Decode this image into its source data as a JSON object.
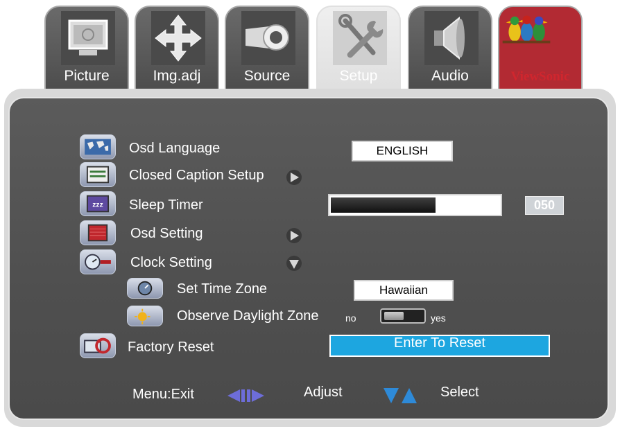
{
  "tabs": [
    {
      "label": "Picture",
      "icon": "monitor-icon"
    },
    {
      "label": "Img.adj",
      "icon": "move-arrows-icon"
    },
    {
      "label": "Source",
      "icon": "connector-icon"
    },
    {
      "label": "Setup",
      "icon": "tools-icon",
      "active": true
    },
    {
      "label": "Audio",
      "icon": "speaker-icon"
    },
    {
      "label": "ViewSonic",
      "icon": "viewsonic-birds-logo"
    }
  ],
  "menu": {
    "osd_language": {
      "label": "Osd Language",
      "value": "ENGLISH",
      "icon": "world-map-icon"
    },
    "closed_caption": {
      "label": "Closed Caption Setup",
      "icon": "caption-icon"
    },
    "sleep_timer": {
      "label": "Sleep Timer",
      "value": "050",
      "level_fraction": 0.62,
      "icon": "zzz-icon"
    },
    "osd_setting": {
      "label": "Osd Setting",
      "icon": "osd-icon"
    },
    "clock_setting": {
      "label": "Clock Setting",
      "icon": "clock-icon"
    },
    "set_time_zone": {
      "label": "Set Time Zone",
      "value": "Hawaiian",
      "icon": "timezone-icon"
    },
    "daylight": {
      "label": "Observe Daylight Zone",
      "off_label": "no",
      "on_label": "yes",
      "icon": "sun-moon-icon"
    },
    "factory_reset": {
      "label": "Factory Reset",
      "action": "Enter To Reset",
      "icon": "reset-icon"
    }
  },
  "footer": {
    "exit": "Menu:Exit",
    "adjust": "Adjust",
    "select": "Select"
  },
  "colors": {
    "accent": "#1da6e0",
    "panel": "#555555",
    "arrow": "#6d6dd9"
  }
}
